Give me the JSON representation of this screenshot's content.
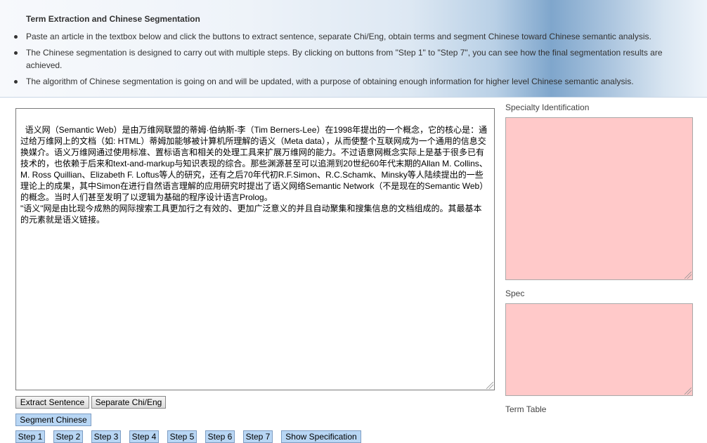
{
  "header": {
    "title": "Term Extraction and Chinese Segmentation",
    "bullets": [
      "Paste an article in the textbox below and click the buttons to extract sentence, separate Chi/Eng, obtain terms and segment Chinese toward Chinese semantic analysis.",
      "The Chinese segmentation is designed to carry out with multiple steps. By clicking on buttons from \"Step 1\" to \"Step 7\", you can see how the final segmentation results are achieved.",
      "The algorithm of Chinese segmentation is going on and will be updated, with a purpose of obtaining enough information for higher level Chinese semantic analysis."
    ]
  },
  "article": {
    "text": "语义网（Semantic Web）是由万维网联盟的蒂姆·伯纳斯-李（Tim Berners-Lee）在1998年提出的一个概念，它的核心是：通过给万维网上的文档（如: HTML）蒂姆加能够被计算机所理解的语义（Meta data），从而使整个互联网成为一个通用的信息交换媒介。语义万维网通过使用标准、置标语言和相关的处理工具来扩展万维网的能力。不过语意网概念实际上是基于很多已有技术的，也依赖于后来和text-and-markup与知识表现的综合。那些渊源甚至可以追溯到20世纪60年代末期的Allan M. Collins、M. Ross Quillian、Elizabeth F. Loftus等人的研究，还有之后70年代初R.F.Simon、R.C.Schamk、Minsky等人陆续提出的一些理论上的成果，其中Simon在进行自然语言理解的应用研究时提出了语义网络Semantic Network（不是现在的Semantic Web）的概念。当时人们甚至发明了以逻辑为基础的程序设计语言Prolog。\n\"语义\"网是由比现今成熟的网际搜索工具更加行之有效的、更加广泛意义的并且自动聚集和搜集信息的文档组成的。其最基本的元素就是语义链接。"
  },
  "right_panel": {
    "specialty_label": "Specialty Identification",
    "spec_label": "Spec",
    "term_table_label": "Term Table"
  },
  "buttons": {
    "extract_sentence": "Extract Sentence",
    "separate_chi_eng": "Separate Chi/Eng",
    "segment_chinese": "Segment Chinese",
    "steps": [
      "Step 1",
      "Step 2",
      "Step 3",
      "Step 4",
      "Step 5",
      "Step 6",
      "Step 7"
    ],
    "show_specification": "Show Specification"
  },
  "colors": {
    "pink_box": "#ffc9c9",
    "blue_button": "#b8d6f4"
  }
}
